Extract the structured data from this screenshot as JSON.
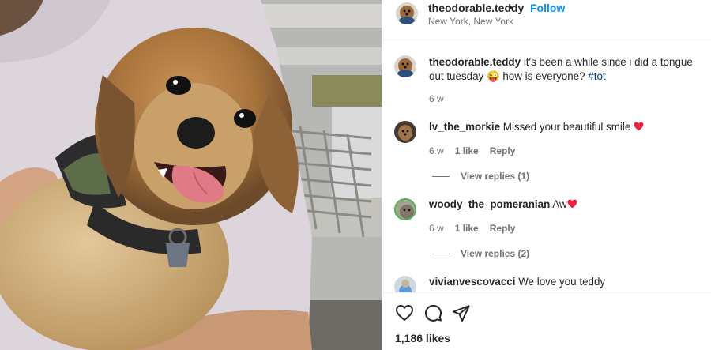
{
  "header": {
    "username": "theodorable.teddy",
    "separator": "•",
    "follow_label": "Follow",
    "location": "New York, New York"
  },
  "caption": {
    "username": "theodorable.teddy",
    "text": "it's been a while since i did a tongue out tuesday 😜 how is everyone?",
    "hashtag": "#tot",
    "age": "6 w"
  },
  "comments": [
    {
      "username": "lv_the_morkie",
      "text": "Missed your beautiful smile",
      "emoji": "heart",
      "age": "6 w",
      "likes": "1 like",
      "reply_label": "Reply",
      "view_replies": "View replies (1)"
    },
    {
      "username": "woody_the_pomeranian",
      "text": "Aw",
      "emoji": "heart",
      "age": "6 w",
      "likes": "1 like",
      "reply_label": "Reply",
      "view_replies": "View replies (2)"
    },
    {
      "username": "vivianvescovacci",
      "text": "We love you teddy"
    }
  ],
  "footer": {
    "likes": "1,186 likes"
  },
  "icons": [
    "heart-icon",
    "comment-icon",
    "share-icon"
  ],
  "colors": {
    "follow": "#0095f6",
    "hashtag": "#00376b",
    "heart_emoji": "#e8243f",
    "muted": "#737373"
  }
}
